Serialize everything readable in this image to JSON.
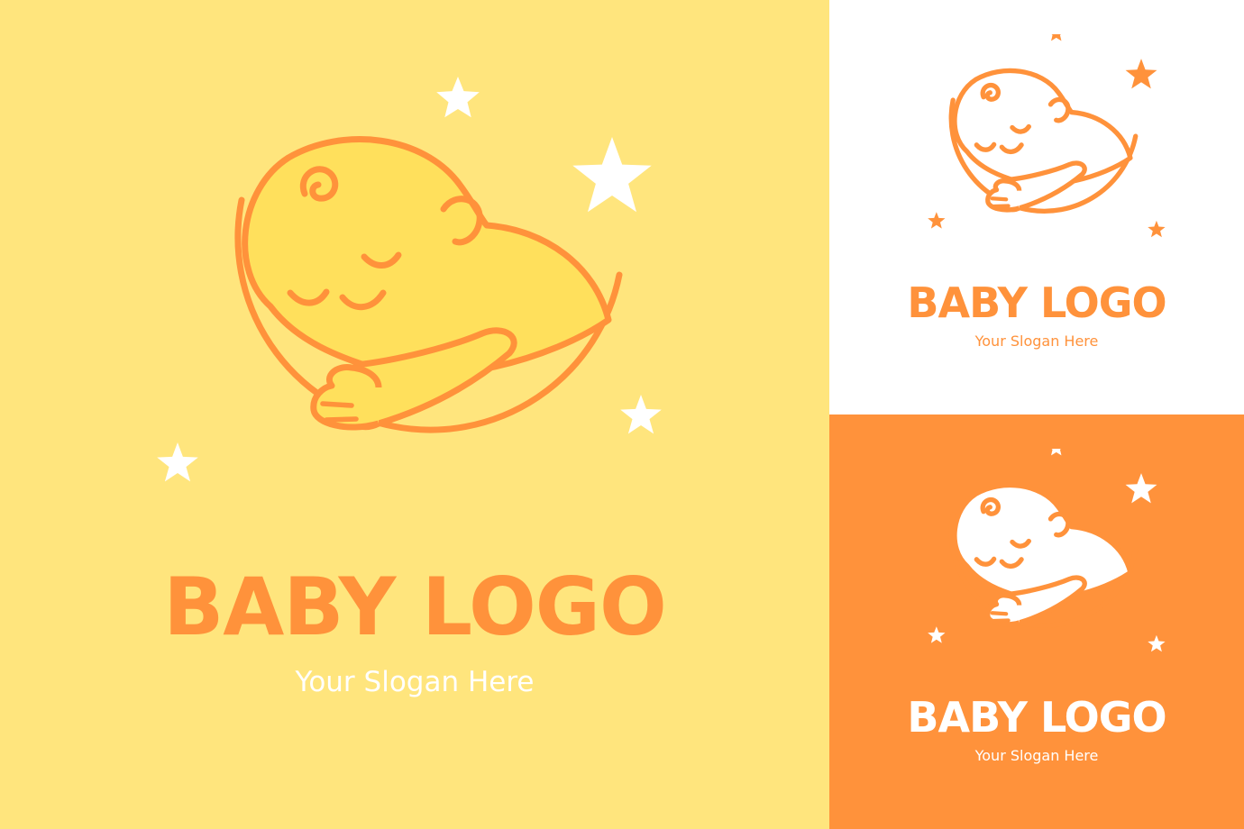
{
  "colors": {
    "yellow_background": "#FFE57D",
    "orange": "#FF923B",
    "white": "#FFFFFF",
    "baby_skin": "#FFE05C"
  },
  "variants": [
    {
      "title": "BABY LOGO",
      "slogan": "Your Slogan Here"
    },
    {
      "title": "BABY LOGO",
      "slogan": "Your Slogan Here"
    },
    {
      "title": "BABY LOGO",
      "slogan": "Your Slogan Here"
    }
  ],
  "icons": [
    "sleeping-baby-on-moon-emblem",
    "star-icon"
  ]
}
